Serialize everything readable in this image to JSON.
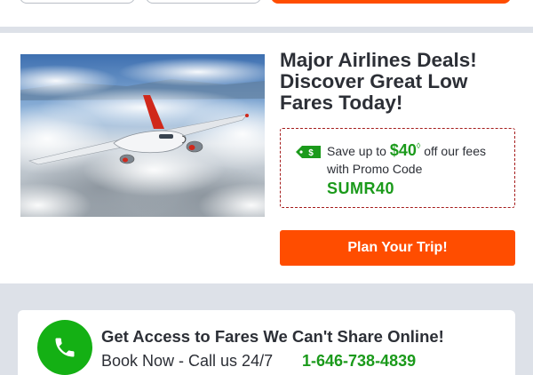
{
  "deal": {
    "headline": [
      "Major Airlines Deals!",
      "Discover Great Low",
      "Fares Today!"
    ],
    "promo": {
      "save_prefix": "Save up to",
      "amount": "$40",
      "amount_mark": "◊",
      "save_suffix": "off our fees",
      "code_label": "with Promo Code",
      "code": "SUMR40",
      "tag_icon_text": "$"
    },
    "cta_label": "Plan Your Trip!"
  },
  "call": {
    "title": "Get Access to Fares We Can't Share Online!",
    "subtitle": "Book Now - Call us 24/7",
    "phone": "1-646-738-4839"
  },
  "colors": {
    "accent": "#ff4d00",
    "green": "#1b9a1b",
    "promo_border": "#a51c1c",
    "page_bg": "#dde1e8"
  }
}
